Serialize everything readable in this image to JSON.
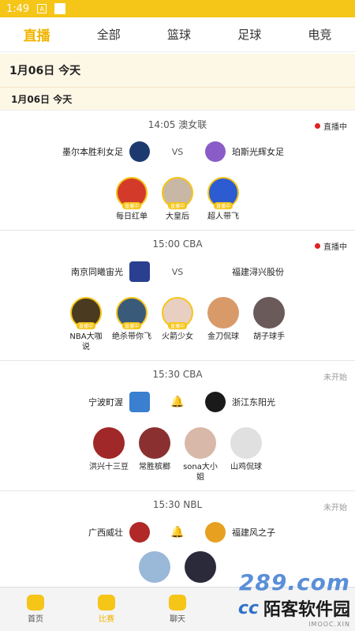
{
  "statusbar": {
    "time": "1:49",
    "badge": "A"
  },
  "tabs": [
    {
      "label": "直播",
      "active": true
    },
    {
      "label": "全部"
    },
    {
      "label": "篮球"
    },
    {
      "label": "足球"
    },
    {
      "label": "电竞"
    }
  ],
  "date_header": "1月06日  今天",
  "date_sub": "1月06日   今天",
  "live_tag": "直播中",
  "matches": [
    {
      "time_league": "14:05  澳女联",
      "status": "直播中",
      "home": "墨尔本胜利女足",
      "away": "珀斯光辉女足",
      "middle": "VS",
      "anchors": [
        "每日红单",
        "大皇后",
        "超人带飞"
      ]
    },
    {
      "time_league": "15:00  CBA",
      "status": "直播中",
      "home": "南京同曦宙光",
      "away": "福建浔兴股份",
      "middle": "VS",
      "anchors": [
        "NBA大咖说",
        "绝杀带你飞",
        "火箭少女",
        "金刀侃球",
        "胡子球手"
      ]
    },
    {
      "time_league": "15:30  CBA",
      "status": "未开始",
      "home": "宁波町渥",
      "away": "浙江东阳光",
      "anchors": [
        "洪兴十三豆",
        "常胜槟榔",
        "sona大小姐",
        "山鸡侃球"
      ]
    },
    {
      "time_league": "15:30  NBL",
      "status": "未开始",
      "home": "广西威壮",
      "away": "福建风之子",
      "anchors": []
    }
  ],
  "bottom_nav": [
    {
      "label": "首页"
    },
    {
      "label": "比赛",
      "active": true
    },
    {
      "label": "聊天"
    }
  ],
  "watermark": {
    "top": "289.com",
    "brand": "陌客软件园",
    "url": "IMOOC.XIN"
  }
}
